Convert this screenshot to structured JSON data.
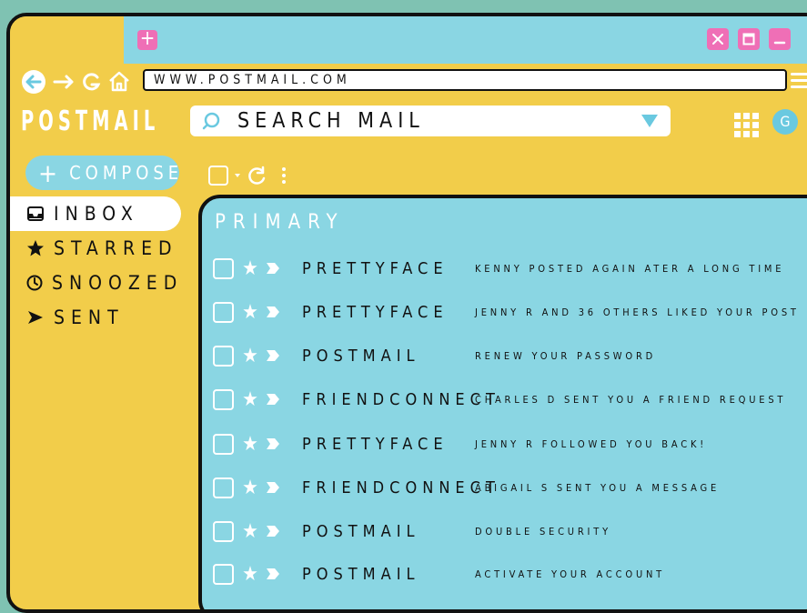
{
  "browser": {
    "new_tab_label": "+",
    "url": "WWW.POSTMAIL.COM"
  },
  "app": {
    "logo": "POSTMAIL",
    "search_placeholder": "SEARCH MAIL",
    "avatar_initial": "G",
    "compose_label": "COMPOSE"
  },
  "nav": {
    "items": [
      {
        "label": "INBOX",
        "icon": "inbox-icon"
      },
      {
        "label": "STARRED",
        "icon": "star-icon"
      },
      {
        "label": "SNOOZED",
        "icon": "clock-icon"
      },
      {
        "label": "SENT",
        "icon": "send-icon"
      }
    ]
  },
  "inbox": {
    "title": "PRIMARY",
    "emails": [
      {
        "sender": "PRETTYFACE",
        "subject": "KENNY POSTED AGAIN ATER A LONG TIME"
      },
      {
        "sender": "PRETTYFACE",
        "subject": "JENNY R  AND 36 OTHERS LIKED YOUR POST"
      },
      {
        "sender": "POSTMAIL",
        "subject": "RENEW YOUR PASSWORD"
      },
      {
        "sender": "FRIENDCONNECT",
        "subject": "CHARLES D  SENT YOU A FRIEND REQUEST"
      },
      {
        "sender": "PRETTYFACE",
        "subject": "JENNY R  FOLLOWED YOU BACK!"
      },
      {
        "sender": "FRIENDCONNECT",
        "subject": "ABIGAIL S SENT YOU A MESSAGE"
      },
      {
        "sender": "POSTMAIL",
        "subject": "DOUBLE SECURITY"
      },
      {
        "sender": "POSTMAIL",
        "subject": "ACTIVATE YOUR ACCOUNT"
      }
    ]
  },
  "colors": {
    "background": "#7fc2b2",
    "frame": "#f2cd4a",
    "panel": "#8ad6e3",
    "accent_pink": "#ef6fb6"
  }
}
